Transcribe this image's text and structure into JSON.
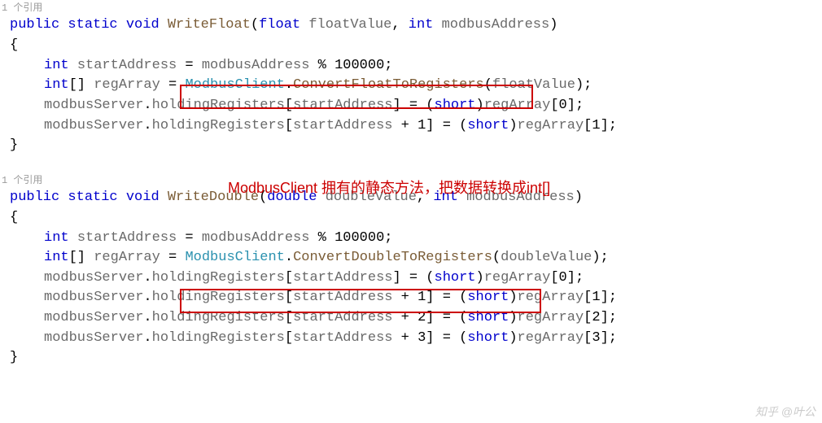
{
  "ref_text": "1 个引用",
  "kw_public": "public",
  "kw_static": "static",
  "kw_void": "void",
  "kw_int": "int",
  "kw_float": "float",
  "kw_double": "double",
  "kw_short": "short",
  "method_wf": "WriteFloat",
  "method_wd": "WriteDouble",
  "param_fv": "floatValue",
  "param_dv": "doubleValue",
  "param_ma": "modbusAddress",
  "var_sa": "startAddress",
  "var_ra": "regArray",
  "mod_num": "100000",
  "cls_mc": "ModbusClient",
  "m_cftr": "ConvertFloatToRegisters",
  "m_cdtr": "ConvertDoubleToRegisters",
  "obj_ms": "modbusServer",
  "prop_hr": "holdingRegisters",
  "annotation": "ModbusClient 拥有的静态方法，把数据转换成int[]",
  "watermark": "知乎 @叶公",
  "idx": {
    "0": "0",
    "1": "1",
    "2": "2",
    "3": "3"
  }
}
